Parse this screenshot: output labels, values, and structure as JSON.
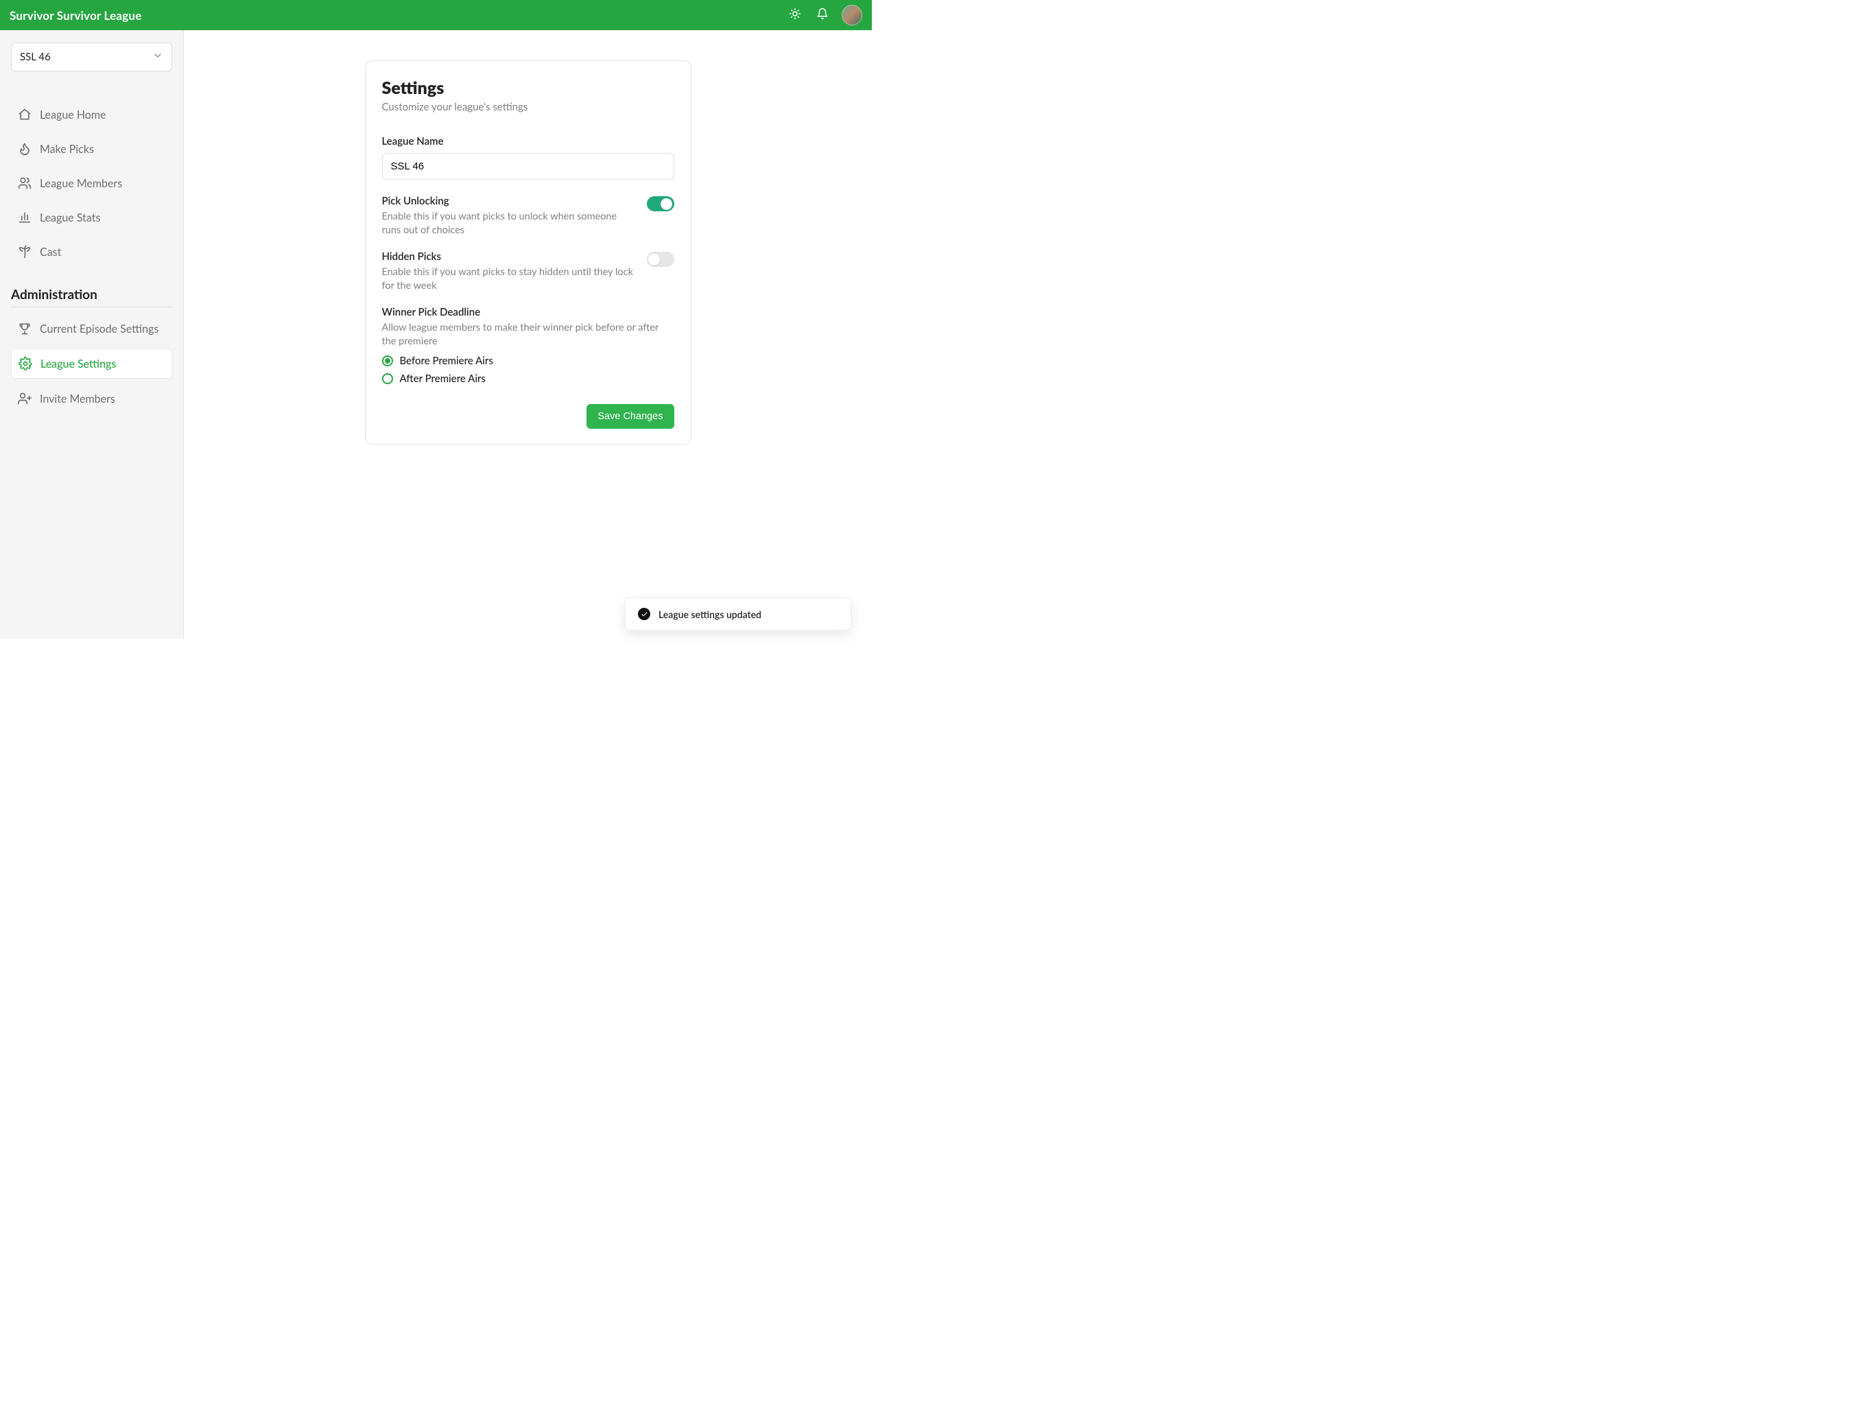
{
  "header": {
    "title": "Survivor Survivor League"
  },
  "sidebar": {
    "league_select": "SSL 46",
    "nav": [
      {
        "label": "League Home"
      },
      {
        "label": "Make Picks"
      },
      {
        "label": "League Members"
      },
      {
        "label": "League Stats"
      },
      {
        "label": "Cast"
      }
    ],
    "admin_heading": "Administration",
    "admin_nav": [
      {
        "label": "Current Episode Settings"
      },
      {
        "label": "League Settings"
      },
      {
        "label": "Invite Members"
      }
    ]
  },
  "card": {
    "title": "Settings",
    "subtitle": "Customize your league's settings",
    "league_name_label": "League Name",
    "league_name_value": "SSL 46",
    "pick_unlocking_title": "Pick Unlocking",
    "pick_unlocking_desc": "Enable this if you want picks to unlock when someone runs out of choices",
    "hidden_picks_title": "Hidden Picks",
    "hidden_picks_desc": "Enable this if you want picks to stay hidden until they lock for the week",
    "winner_deadline_title": "Winner Pick Deadline",
    "winner_deadline_desc": "Allow league members to make their winner pick before or after the premiere",
    "radio_before": "Before Premiere Airs",
    "radio_after": "After Premiere Airs",
    "save_button": "Save Changes"
  },
  "toast": {
    "message": "League settings updated"
  }
}
